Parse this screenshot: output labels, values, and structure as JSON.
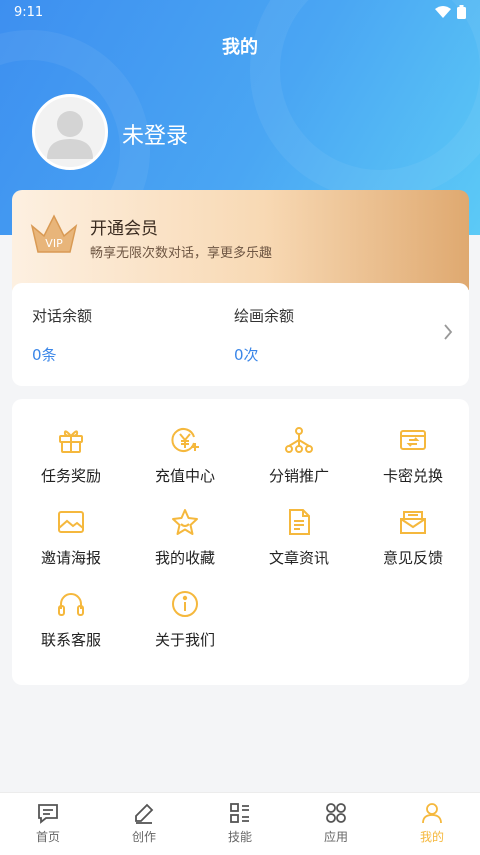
{
  "status_bar": {
    "time": "9:11"
  },
  "header": {
    "title": "我的"
  },
  "profile": {
    "username": "未登录"
  },
  "vip": {
    "title": "开通会员",
    "subtitle": "畅享无限次数对话，享更多乐趣",
    "badge_text": "VIP"
  },
  "balance": {
    "chat_label": "对话余额",
    "chat_value": "0条",
    "draw_label": "绘画余额",
    "draw_value": "0次"
  },
  "menu": {
    "items": [
      {
        "label": "任务奖励",
        "icon": "gift-icon"
      },
      {
        "label": "充值中心",
        "icon": "yen-coin-icon"
      },
      {
        "label": "分销推广",
        "icon": "share-tree-icon"
      },
      {
        "label": "卡密兑换",
        "icon": "card-exchange-icon"
      },
      {
        "label": "邀请海报",
        "icon": "poster-image-icon"
      },
      {
        "label": "我的收藏",
        "icon": "star-icon"
      },
      {
        "label": "文章资讯",
        "icon": "document-icon"
      },
      {
        "label": "意见反馈",
        "icon": "feedback-mail-icon"
      },
      {
        "label": "联系客服",
        "icon": "headphones-icon"
      },
      {
        "label": "关于我们",
        "icon": "info-icon"
      }
    ],
    "icon_color": "#f5b83d"
  },
  "bottom_nav": {
    "items": [
      {
        "label": "首页",
        "icon": "chat-bubble-icon"
      },
      {
        "label": "创作",
        "icon": "pen-icon"
      },
      {
        "label": "技能",
        "icon": "skill-list-icon"
      },
      {
        "label": "应用",
        "icon": "apps-icon"
      },
      {
        "label": "我的",
        "icon": "user-icon"
      }
    ],
    "active": "我的",
    "active_color": "#f5b83d"
  }
}
